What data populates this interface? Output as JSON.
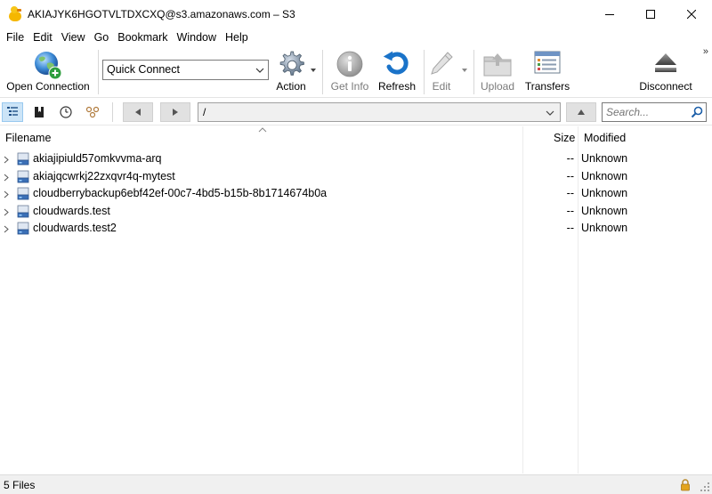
{
  "window": {
    "title": "AKIAJYK6HGOTVLTDXCXQ@s3.amazonaws.com – S3"
  },
  "menu": [
    "File",
    "Edit",
    "View",
    "Go",
    "Bookmark",
    "Window",
    "Help"
  ],
  "toolbar": {
    "open_connection": "Open Connection",
    "quick_connect": "Quick Connect",
    "action": "Action",
    "get_info": "Get Info",
    "refresh": "Refresh",
    "edit": "Edit",
    "upload": "Upload",
    "transfers": "Transfers",
    "disconnect": "Disconnect",
    "overflow": "»"
  },
  "nav": {
    "path": "/",
    "search_placeholder": "Search..."
  },
  "columns": {
    "filename": "Filename",
    "size": "Size",
    "modified": "Modified"
  },
  "files": [
    {
      "name": "akiajipiuld57omkvvma-arq",
      "size": "--",
      "modified": "Unknown"
    },
    {
      "name": "akiajqcwrkj22zxqvr4q-mytest",
      "size": "--",
      "modified": "Unknown"
    },
    {
      "name": "cloudberrybackup6ebf42ef-00c7-4bd5-b15b-8b1714674b0a",
      "size": "--",
      "modified": "Unknown"
    },
    {
      "name": "cloudwards.test",
      "size": "--",
      "modified": "Unknown"
    },
    {
      "name": "cloudwards.test2",
      "size": "--",
      "modified": "Unknown"
    }
  ],
  "status": {
    "text": "5 Files"
  },
  "colors": {
    "accent": "#0078d7",
    "selected_bg": "#cce4f7",
    "refresh_blue": "#1a73c9",
    "disabled_gray": "#9a9a9a"
  }
}
